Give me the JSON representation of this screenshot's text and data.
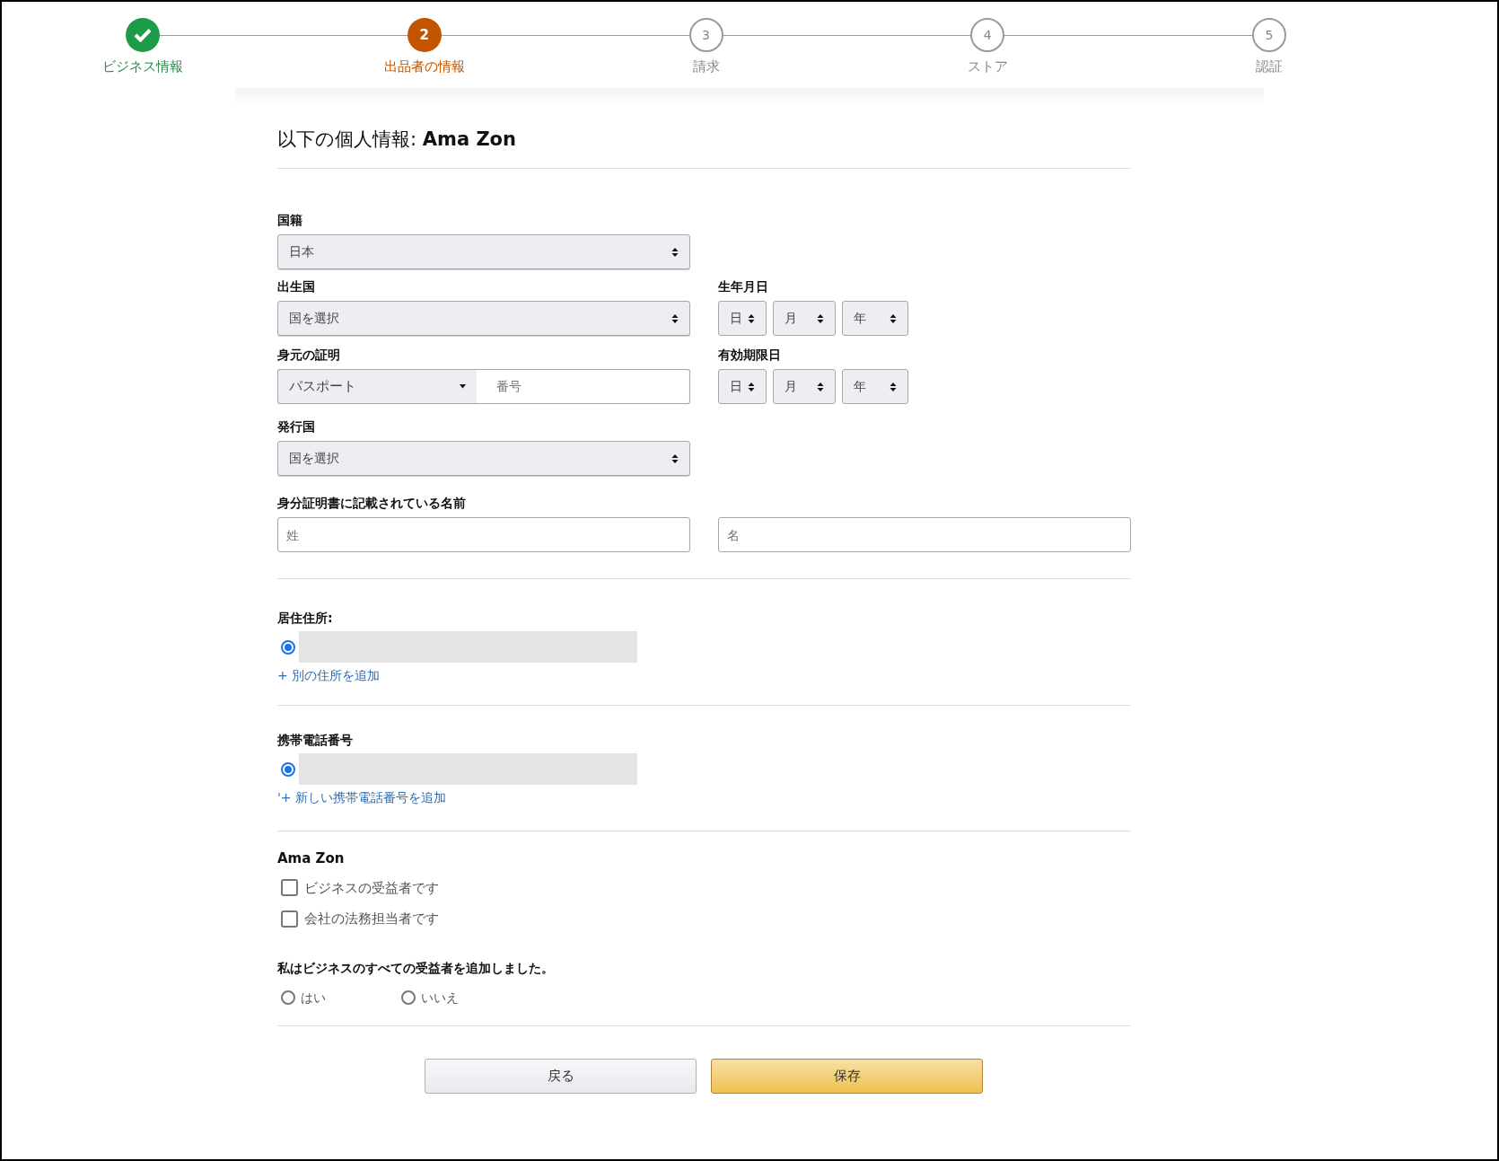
{
  "stepper": {
    "steps": [
      {
        "label": "ビジネス情報",
        "completed": true,
        "selected": false
      },
      {
        "label": "出品者の情報",
        "number": "2",
        "completed": false,
        "selected": true
      },
      {
        "label": "請求",
        "number": "3",
        "completed": false,
        "selected": false
      },
      {
        "label": "ストア",
        "number": "4",
        "completed": false,
        "selected": false
      },
      {
        "label": "認証",
        "number": "5",
        "completed": false,
        "selected": false
      }
    ]
  },
  "title": "以下の個人情報: **Ama Zon**",
  "nationality": {
    "label": "国籍",
    "value": "日本"
  },
  "birth_country": {
    "label": "出生国",
    "value": "国を選択"
  },
  "birth_date": {
    "label": "生年月日",
    "selects": [
      "日",
      "月",
      "年"
    ]
  },
  "identity": {
    "label": "身元の証明",
    "doc_type": "パスポート",
    "number_placeholder": "番号"
  },
  "expiry_date": {
    "label": "有効期限日",
    "selects": [
      "日",
      "月",
      "年"
    ]
  },
  "issuing_country": {
    "label": "発行国",
    "value": "国を選択"
  },
  "id_name": {
    "label": "身分証明書に記載されている名前",
    "last_placeholder": "姓",
    "first_placeholder": "名"
  },
  "address": {
    "label": "居住住所:",
    "selected": true,
    "link": "+ 別の住所を追加"
  },
  "mobile": {
    "label": "携帯電話番号",
    "selected": true,
    "link": "'+ 新しい携帯電話番号を追加"
  },
  "person": {
    "name": "Ama Zon",
    "roles": [
      {
        "label": "ビジネスの受益者です",
        "checked": false
      },
      {
        "label": "会社の法務担当者です",
        "checked": false
      }
    ]
  },
  "beneficiaries": {
    "question": "私はビジネスのすべての受益者を追加しました。",
    "options": [
      {
        "label": "はい",
        "selected": false
      },
      {
        "label": "いいえ",
        "selected": false
      }
    ]
  },
  "buttons": [
    {
      "label": "戻る",
      "kind": "secondary"
    },
    {
      "label": "保存",
      "kind": "primary"
    }
  ]
}
